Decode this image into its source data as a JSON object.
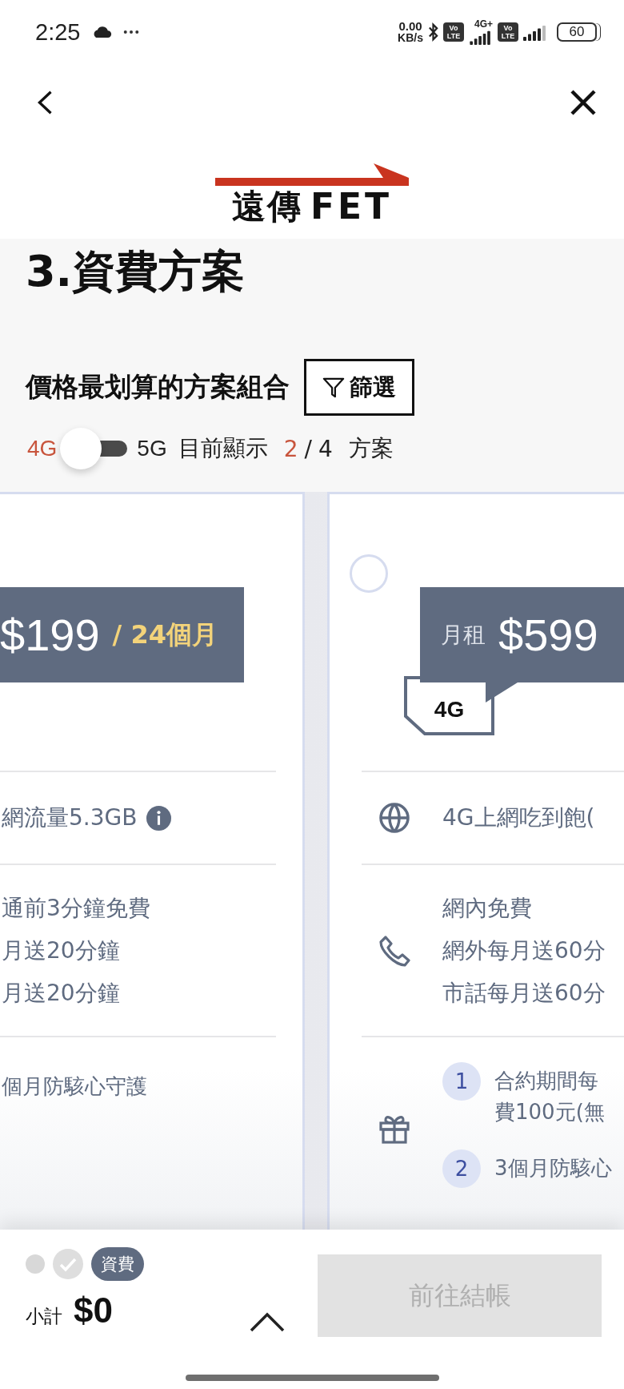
{
  "status_bar": {
    "time": "2:25",
    "net_speed": "0.00",
    "net_unit": "KB/s",
    "volte_badges": [
      {
        "top": "Vo",
        "bottom": "LTE"
      },
      {
        "top": "Vo",
        "bottom": "LTE"
      }
    ],
    "network": "4G+",
    "battery": "60"
  },
  "brand": {
    "name_cn": "遠傳",
    "name_en": "FET"
  },
  "page_title": "3.資費方案",
  "section_heading": "價格最划算的方案組合",
  "filter_button": {
    "label": "篩選"
  },
  "network_toggle": {
    "left_label": "4G",
    "right_label": "5G",
    "on": false
  },
  "plan_count": {
    "prefix": "目前顯示",
    "shown": "2",
    "separator": "/",
    "total": "4",
    "suffix": "方案"
  },
  "plans": [
    {
      "icons": false,
      "price": "$199",
      "term": "/ 24個月",
      "rows": [
        {
          "kind": "data",
          "lines": [
            "網流量5.3GB"
          ],
          "info": true
        },
        {
          "kind": "voice",
          "lines": [
            "通前3分鐘免費",
            "月送20分鐘",
            "月送20分鐘"
          ]
        },
        {
          "kind": "gift",
          "items": [
            {
              "lines": [
                "個月防駭心守護"
              ]
            }
          ]
        }
      ]
    },
    {
      "icons": true,
      "selected": false,
      "price_label": "月租",
      "price": "$599",
      "network": "4G",
      "rows": [
        {
          "kind": "data",
          "lines": [
            "4G上網吃到飽("
          ]
        },
        {
          "kind": "voice",
          "lines": [
            "網內免費",
            "網外每月送60分",
            "市話每月送60分"
          ]
        },
        {
          "kind": "gift",
          "items": [
            {
              "number": "1",
              "lines": [
                "合約期間每",
                "費100元(無"
              ]
            },
            {
              "number": "2",
              "lines": [
                "3個月防駭心"
              ]
            }
          ]
        }
      ]
    }
  ],
  "progress_steps": [
    {
      "kind": "dot"
    },
    {
      "kind": "check"
    },
    {
      "kind": "current",
      "label": "資費"
    }
  ],
  "subtotal": {
    "label": "小計",
    "amount": "$0"
  },
  "checkout_button": {
    "label": "前往結帳",
    "disabled": true
  }
}
